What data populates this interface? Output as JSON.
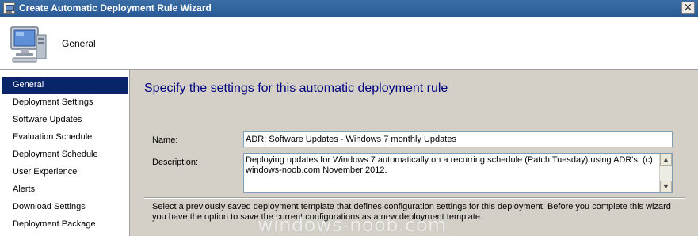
{
  "window": {
    "title": "Create Automatic Deployment Rule Wizard",
    "close_glyph": "×"
  },
  "header": {
    "title": "General",
    "icon": "computer-icon"
  },
  "sidebar": {
    "items": [
      {
        "label": "General",
        "active": true
      },
      {
        "label": "Deployment Settings"
      },
      {
        "label": "Software Updates"
      },
      {
        "label": "Evaluation Schedule"
      },
      {
        "label": "Deployment Schedule"
      },
      {
        "label": "User Experience"
      },
      {
        "label": "Alerts"
      },
      {
        "label": "Download Settings"
      },
      {
        "label": "Deployment Package"
      }
    ]
  },
  "main": {
    "heading": "Specify the settings for this automatic deployment rule",
    "name_label": "Name:",
    "name_value": "ADR: Software Updates - Windows 7 monthly Updates",
    "description_label": "Description:",
    "description_value": "Deploying updates for Windows 7 automatically on a recurring schedule (Patch Tuesday) using ADR's. (c) windows-noob.com November 2012.",
    "info_text": "Select a previously saved deployment template that defines configuration settings for this deployment. Before you complete this wizard you have the option to save the current configurations as a new deployment template."
  },
  "watermark": "windows-noob.com",
  "colors": {
    "titlebar": "#3a6ea5",
    "selection": "#0a246a",
    "heading": "#00007f",
    "dialog_bg": "#d4d0c8"
  }
}
